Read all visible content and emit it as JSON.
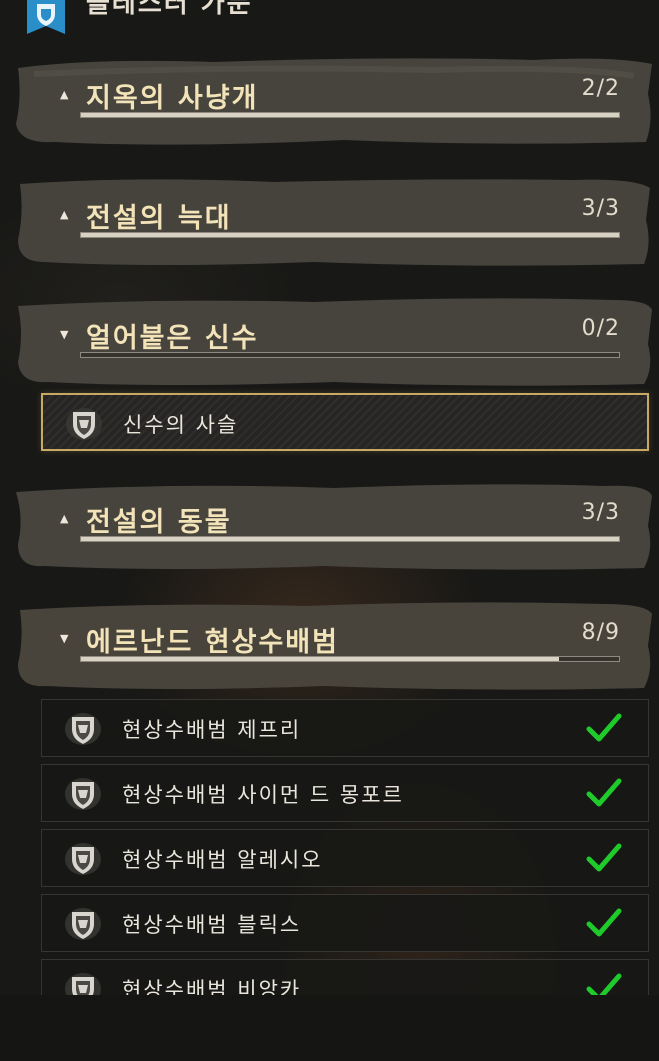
{
  "panel": {
    "title": "블레스터 가문",
    "banner_color": "#2a8fc8"
  },
  "categories": [
    {
      "label": "지옥의 사냥개",
      "count": "2/2",
      "progress": 1.0,
      "expanded": false
    },
    {
      "label": "전설의 늑대",
      "count": "3/3",
      "progress": 1.0,
      "expanded": false
    },
    {
      "label": "얼어붙은 신수",
      "count": "0/2",
      "progress": 0.0,
      "expanded": true
    },
    {
      "label": "전설의 동물",
      "count": "3/3",
      "progress": 1.0,
      "expanded": false
    },
    {
      "label": "에르난드 현상수배범",
      "count": "8/9",
      "progress": 0.889,
      "expanded": true
    }
  ],
  "frozen_items": [
    {
      "label": "신수의 사슬",
      "selected": true,
      "completed": false
    }
  ],
  "bounty_items": [
    {
      "label": "현상수배범 제프리",
      "completed": true
    },
    {
      "label": "현상수배범 사이먼 드 몽포르",
      "completed": true
    },
    {
      "label": "현상수배범 알레시오",
      "completed": true
    },
    {
      "label": "현상수배범 블릭스",
      "completed": true
    },
    {
      "label": "현상수배범 비앙카",
      "completed": true
    }
  ],
  "colors": {
    "accent_gold": "#c8a865",
    "check_green": "#1fcb2a",
    "header_text": "#f2e3b9"
  }
}
